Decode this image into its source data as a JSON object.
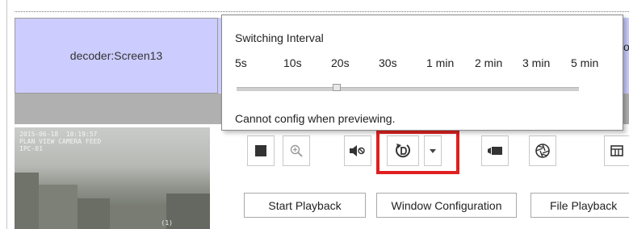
{
  "decoder": {
    "screen_label": "decoder:Screen13"
  },
  "popup": {
    "title": "Switching Interval",
    "options": [
      "5s",
      "10s",
      "20s",
      "30s",
      "1 min",
      "2 min",
      "3 min",
      "5 min"
    ],
    "selected_option": "20s",
    "message": "Cannot config when previewing."
  },
  "toolbar": {
    "icons": [
      "stop-icon",
      "zoom-icon",
      "mute-icon",
      "switch-interval-icon",
      "chevron-down-icon",
      "record-icon",
      "aperture-icon",
      "layout-icon"
    ]
  },
  "buttons": {
    "start_playback": "Start Playback",
    "window_configuration": "Window Configuration",
    "file_playback": "File Playback"
  },
  "colors": {
    "tile": "#ccccff",
    "highlight": "#e02020"
  }
}
